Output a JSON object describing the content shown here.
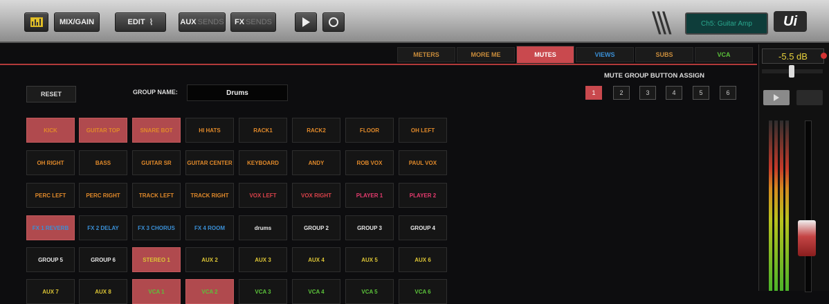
{
  "toolbar": {
    "mix_gain": "MIX/GAIN",
    "edit": "EDIT",
    "aux": "AUX",
    "aux_sub": "SENDS",
    "fx": "FX",
    "fx_sub": "SENDS",
    "display_text": "Ch5: Guitar Amp",
    "logo": "Ui"
  },
  "tabs": [
    {
      "label": "METERS",
      "active": false
    },
    {
      "label": "MORE ME",
      "active": false
    },
    {
      "label": "MUTES",
      "active": true
    },
    {
      "label": "VIEWS",
      "active": false
    },
    {
      "label": "SUBS",
      "active": false
    },
    {
      "label": "VCA",
      "active": false
    }
  ],
  "channel_strip": {
    "gain": "-5.5 dB",
    "colors": {
      "gain_text": "#e8d23c",
      "fader": "#c54545"
    }
  },
  "controls": {
    "reset": "RESET",
    "group_name_label": "GROUP NAME:",
    "group_name_value": "Drums"
  },
  "assign": {
    "title": "MUTE GROUP BUTTON ASSIGN",
    "buttons": [
      "1",
      "2",
      "3",
      "4",
      "5",
      "6"
    ],
    "active_index": 0
  },
  "colors": {
    "accent": "#c9494e",
    "orange": "#e0892a",
    "red": "#d9424a",
    "pink": "#e43b6e",
    "blue": "#3a8fd6",
    "white": "#e6e6e6",
    "yellow": "#dbc435",
    "green": "#5bc23a"
  },
  "channels": [
    [
      {
        "label": "KICK",
        "color": "orange",
        "on": true
      },
      {
        "label": "GUITAR TOP",
        "color": "orange",
        "on": true
      },
      {
        "label": "SNARE BOT",
        "color": "orange",
        "on": true
      },
      {
        "label": "HI HATS",
        "color": "orange",
        "on": false
      },
      {
        "label": "RACK1",
        "color": "orange",
        "on": false
      },
      {
        "label": "RACK2",
        "color": "orange",
        "on": false
      },
      {
        "label": "FLOOR",
        "color": "orange",
        "on": false
      },
      {
        "label": "OH LEFT",
        "color": "orange",
        "on": false
      }
    ],
    [
      {
        "label": "OH RIGHT",
        "color": "orange",
        "on": false
      },
      {
        "label": "BASS",
        "color": "orange",
        "on": false
      },
      {
        "label": "GUITAR SR",
        "color": "orange",
        "on": false
      },
      {
        "label": "GUITAR CENTER",
        "color": "orange",
        "on": false
      },
      {
        "label": "KEYBOARD",
        "color": "orange",
        "on": false
      },
      {
        "label": "ANDY",
        "color": "orange",
        "on": false
      },
      {
        "label": "ROB VOX",
        "color": "orange",
        "on": false
      },
      {
        "label": "PAUL VOX",
        "color": "orange",
        "on": false
      }
    ],
    [
      {
        "label": "PERC LEFT",
        "color": "orange",
        "on": false
      },
      {
        "label": "PERC RIGHT",
        "color": "orange",
        "on": false
      },
      {
        "label": "TRACK LEFT",
        "color": "orange",
        "on": false
      },
      {
        "label": "TRACK RIGHT",
        "color": "orange",
        "on": false
      },
      {
        "label": "VOX LEFT",
        "color": "red",
        "on": false
      },
      {
        "label": "VOX RIGHT",
        "color": "red",
        "on": false
      },
      {
        "label": "PLAYER 1",
        "color": "pink",
        "on": false
      },
      {
        "label": "PLAYER 2",
        "color": "pink",
        "on": false
      }
    ],
    [
      {
        "label": "FX 1 REVERB",
        "color": "blue",
        "on": true
      },
      {
        "label": "FX 2 DELAY",
        "color": "blue",
        "on": false
      },
      {
        "label": "FX 3 CHORUS",
        "color": "blue",
        "on": false
      },
      {
        "label": "FX 4 ROOM",
        "color": "blue",
        "on": false
      },
      {
        "label": "drums",
        "color": "white",
        "on": false
      },
      {
        "label": "GROUP 2",
        "color": "white",
        "on": false
      },
      {
        "label": "GROUP 3",
        "color": "white",
        "on": false
      },
      {
        "label": "GROUP 4",
        "color": "white",
        "on": false
      }
    ],
    [
      {
        "label": "GROUP 5",
        "color": "white",
        "on": false
      },
      {
        "label": "GROUP 6",
        "color": "white",
        "on": false
      },
      {
        "label": "STEREO 1",
        "color": "yellow",
        "on": true
      },
      {
        "label": "AUX 2",
        "color": "yellow",
        "on": false
      },
      {
        "label": "AUX 3",
        "color": "yellow",
        "on": false
      },
      {
        "label": "AUX 4",
        "color": "yellow",
        "on": false
      },
      {
        "label": "AUX 5",
        "color": "yellow",
        "on": false
      },
      {
        "label": "AUX 6",
        "color": "yellow",
        "on": false
      }
    ],
    [
      {
        "label": "AUX 7",
        "color": "yellow",
        "on": false
      },
      {
        "label": "AUX 8",
        "color": "yellow",
        "on": false
      },
      {
        "label": "VCA 1",
        "color": "green",
        "on": true
      },
      {
        "label": "VCA 2",
        "color": "green",
        "on": true
      },
      {
        "label": "VCA 3",
        "color": "green",
        "on": false
      },
      {
        "label": "VCA 4",
        "color": "green",
        "on": false
      },
      {
        "label": "VCA 5",
        "color": "green",
        "on": false
      },
      {
        "label": "VCA 6",
        "color": "green",
        "on": false
      }
    ]
  ]
}
